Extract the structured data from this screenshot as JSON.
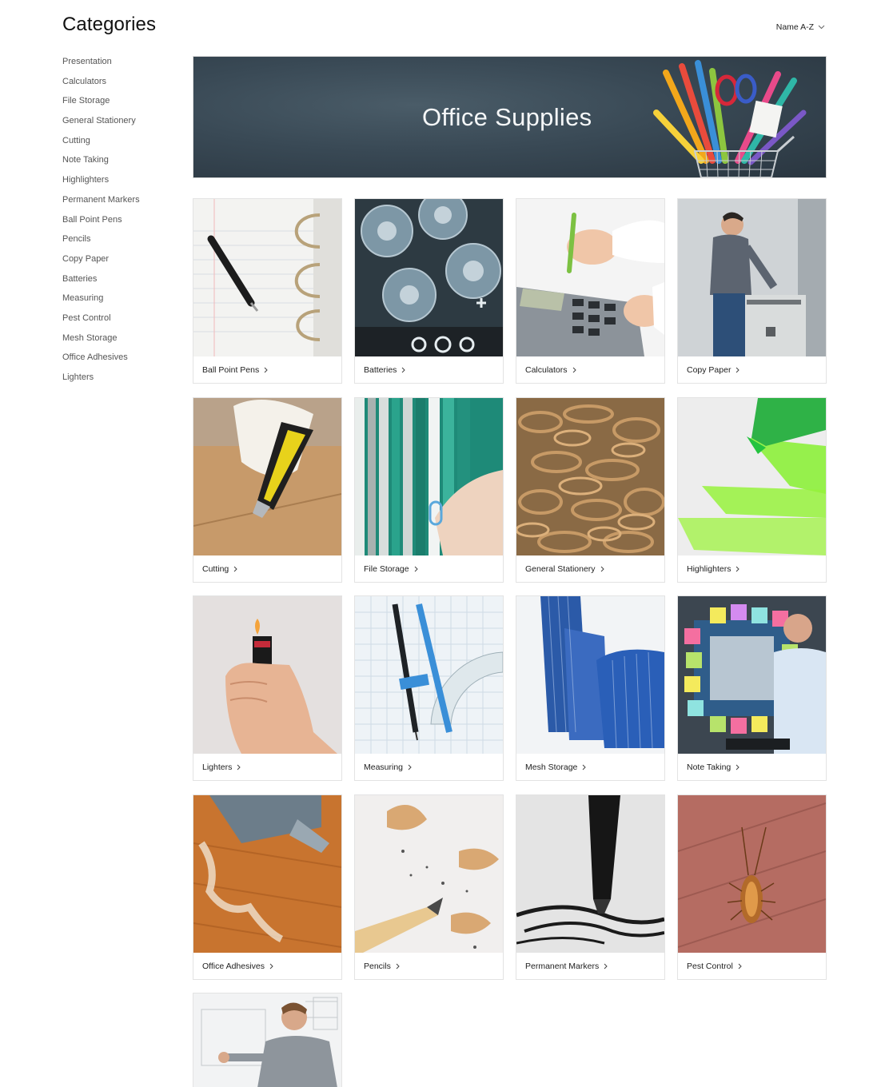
{
  "header": {
    "title": "Categories",
    "sort_label": "Name A-Z",
    "sort_icon": "chevron-down-icon"
  },
  "sidebar": {
    "items": [
      {
        "label": "Presentation"
      },
      {
        "label": "Calculators"
      },
      {
        "label": "File Storage"
      },
      {
        "label": "General Stationery"
      },
      {
        "label": "Cutting"
      },
      {
        "label": "Note Taking"
      },
      {
        "label": "Highlighters"
      },
      {
        "label": "Permanent Markers"
      },
      {
        "label": "Ball Point Pens"
      },
      {
        "label": "Pencils"
      },
      {
        "label": "Copy Paper"
      },
      {
        "label": "Batteries"
      },
      {
        "label": "Measuring"
      },
      {
        "label": "Pest Control"
      },
      {
        "label": "Mesh Storage"
      },
      {
        "label": "Office Adhesives"
      },
      {
        "label": "Lighters"
      }
    ]
  },
  "banner": {
    "title": "Office Supplies"
  },
  "cards": [
    {
      "label": "Ball Point Pens",
      "image": "ball-point-pen-photo"
    },
    {
      "label": "Batteries",
      "image": "batteries-photo"
    },
    {
      "label": "Calculators",
      "image": "calculator-photo"
    },
    {
      "label": "Copy Paper",
      "image": "copier-photo"
    },
    {
      "label": "Cutting",
      "image": "box-cutter-photo"
    },
    {
      "label": "File Storage",
      "image": "file-folders-photo"
    },
    {
      "label": "General Stationery",
      "image": "rubber-bands-photo"
    },
    {
      "label": "Highlighters",
      "image": "highlighter-photo"
    },
    {
      "label": "Lighters",
      "image": "lighter-photo"
    },
    {
      "label": "Measuring",
      "image": "compass-protractor-photo"
    },
    {
      "label": "Mesh Storage",
      "image": "mesh-file-holder-photo"
    },
    {
      "label": "Note Taking",
      "image": "sticky-notes-photo"
    },
    {
      "label": "Office Adhesives",
      "image": "glue-gun-photo"
    },
    {
      "label": "Pencils",
      "image": "pencil-shavings-photo"
    },
    {
      "label": "Permanent Markers",
      "image": "marker-photo"
    },
    {
      "label": "Pest Control",
      "image": "cockroach-photo"
    },
    {
      "label": "",
      "image": "presentation-whiteboard-photo"
    }
  ]
}
